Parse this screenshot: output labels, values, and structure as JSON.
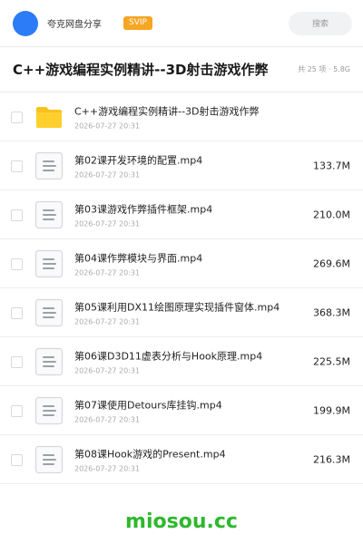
{
  "header": {
    "share_name": "夸克网盘分享",
    "badge": "SVIP",
    "search_placeholder": "搜索",
    "avatar_color": "#2b7cf6",
    "badge_color": "#f5a623"
  },
  "title": "C++游戏编程实例精讲--3D射击游戏作弊",
  "summary": "共 25 项 · 5.8G",
  "files": [
    {
      "name": "C++游戏编程实例精讲--3D射击游戏作弊",
      "date": "2026-07-27 20:31",
      "size": "",
      "icon": "folder-icon"
    },
    {
      "name": "第02课开发环境的配置.mp4",
      "date": "2026-07-27 20:31",
      "size": "133.7M",
      "icon": "document-icon"
    },
    {
      "name": "第03课游戏作弊插件框架.mp4",
      "date": "2026-07-27 20:31",
      "size": "210.0M",
      "icon": "document-icon"
    },
    {
      "name": "第04课作弊模块与界面.mp4",
      "date": "2026-07-27 20:31",
      "size": "269.6M",
      "icon": "document-icon"
    },
    {
      "name": "第05课利用DX11绘图原理实现插件窗体.mp4",
      "date": "2026-07-27 20:31",
      "size": "368.3M",
      "icon": "document-icon"
    },
    {
      "name": "第06课D3D11虚表分析与Hook原理.mp4",
      "date": "2026-07-27 20:31",
      "size": "225.5M",
      "icon": "document-icon"
    },
    {
      "name": "第07课使用Detours库挂钩.mp4",
      "date": "2026-07-27 20:31",
      "size": "199.9M",
      "icon": "document-icon"
    },
    {
      "name": "第08课Hook游戏的Present.mp4",
      "date": "2026-07-27 20:31",
      "size": "216.3M",
      "icon": "document-icon"
    }
  ],
  "watermark": "miosou.cc",
  "watermark_color": "#2eb82e"
}
